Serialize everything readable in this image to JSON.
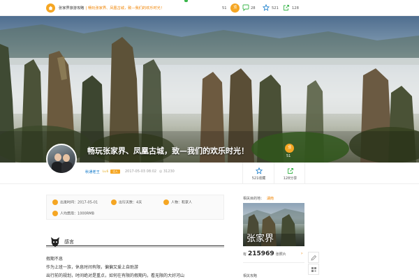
{
  "topbar": {
    "breadcrumb_home": "张家界旅游攻略",
    "breadcrumb_current": "畅玩张家界、凤凰古城，致—我们的欢乐时光！",
    "zan_label": "顶",
    "zan_count": "51",
    "comment_count": "28",
    "favorite_count": "521",
    "share_count": "128"
  },
  "hero": {
    "title": "畅玩张家界、凤凰古城，致—我们的欢乐时光！",
    "zan_label": "顶",
    "zan_count": "51"
  },
  "author": {
    "name": "秋通老王",
    "level": "Lv.6",
    "badge": "达人",
    "time": "2017-05-03 08:02",
    "views": "31230"
  },
  "actions": {
    "favorite": "521收藏",
    "share": "128分享"
  },
  "trip_info": {
    "depart_label": "出发时间：",
    "depart_value": "2017-05-01",
    "days_label": "出行天数：",
    "days_value": "4天",
    "people_label": "人物：",
    "people_value": "和家人",
    "cost_label": "人均费用：",
    "cost_value": "1000RMB"
  },
  "section": {
    "title": "感言",
    "lines": [
      "假期不息",
      "作为上班一族，休息时间有限，偏偏又爱上自助游",
      "出行前的规划，时间绝对是重点，如何在有限的假期内，看无限的大好河山"
    ]
  },
  "sidebar": {
    "related_label": "相关目的地：",
    "related_keyword": "湖南",
    "dest_name": "张家界",
    "photos_prefix": "有",
    "photos_count": "215969",
    "photos_suffix": "张照片",
    "bottom_label": "相关攻略"
  },
  "colors": {
    "accent": "#f5a623",
    "link": "#0e77c9",
    "highlight": "#f08300"
  },
  "icons": [
    "home-icon",
    "comment-icon",
    "star-icon",
    "share-icon",
    "eye-icon",
    "pencil-icon",
    "qrcode-icon"
  ]
}
